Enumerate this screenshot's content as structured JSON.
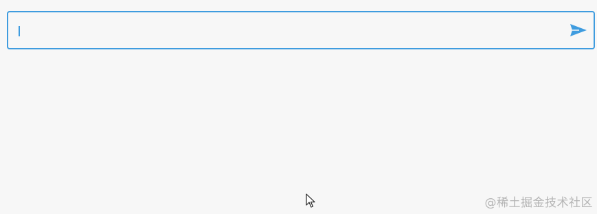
{
  "input": {
    "value": "",
    "placeholder": ""
  },
  "send_button": {
    "icon": "send-icon"
  },
  "watermark": {
    "text": "@稀土掘金技术社区"
  },
  "colors": {
    "accent": "#3f9cdf",
    "background": "#f7f7f7",
    "watermark": "#b4b4b4"
  }
}
